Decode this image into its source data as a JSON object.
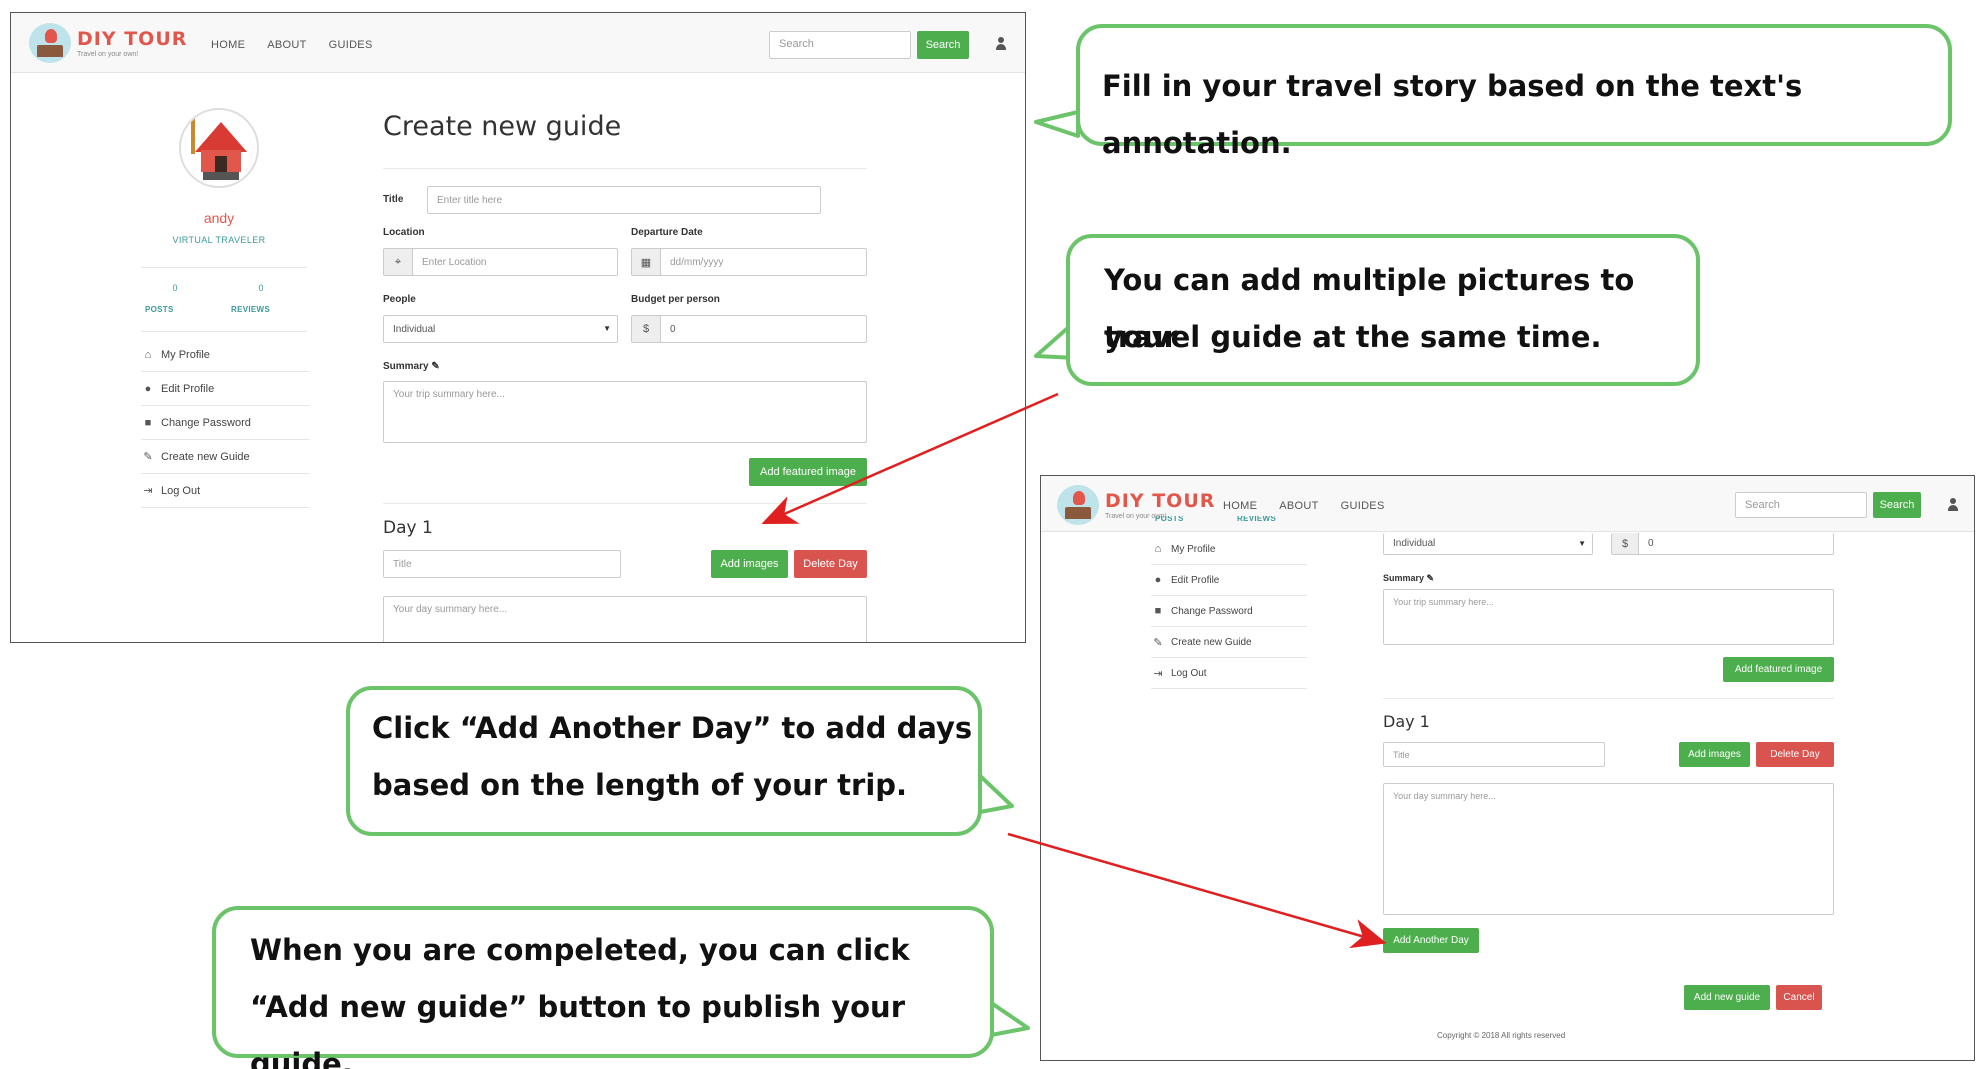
{
  "brand": {
    "name": "DIY TOUR",
    "tagline": "Travel on your own!"
  },
  "nav": {
    "links": [
      "HOME",
      "ABOUT",
      "GUIDES"
    ],
    "search_placeholder": "Search",
    "search_button": "Search"
  },
  "profile": {
    "name": "andy",
    "role": "VIRTUAL TRAVELER",
    "posts_count": "0",
    "posts_label": "POSTS",
    "reviews_count": "0",
    "reviews_label": "REVIEWS"
  },
  "menu": [
    {
      "label": "My Profile",
      "icon": "home-icon"
    },
    {
      "label": "Edit Profile",
      "icon": "user-icon"
    },
    {
      "label": "Change Password",
      "icon": "lock-icon"
    },
    {
      "label": "Create new Guide",
      "icon": "pencil-icon"
    },
    {
      "label": "Log Out",
      "icon": "logout-icon"
    }
  ],
  "form": {
    "page_title": "Create new guide",
    "title_label": "Title",
    "title_placeholder": "Enter title here",
    "location_label": "Location",
    "location_placeholder": "Enter Location",
    "departure_label": "Departure Date",
    "departure_placeholder": "dd/mm/yyyy",
    "people_label": "People",
    "people_value": "Individual",
    "budget_label": "Budget per person",
    "budget_prefix": "$",
    "budget_value": "0",
    "summary_label": "Summary",
    "summary_placeholder": "Your trip summary here...",
    "featured_button": "Add featured image"
  },
  "day": {
    "title": "Day 1",
    "title_placeholder": "Title",
    "add_images_button": "Add images",
    "delete_day_button": "Delete Day",
    "summary_placeholder": "Your day summary here...",
    "add_day_button": "Add Another Day"
  },
  "footer_actions": {
    "add_guide_button": "Add new guide",
    "cancel_button": "Cancel"
  },
  "copyright": "Copyright © 2018 All rights reserved",
  "callouts": {
    "c1": [
      "Fill in your travel story based on the text's annotation."
    ],
    "c2": [
      "You can add multiple pictures to your",
      "travel guide at the same time."
    ],
    "c3": [
      "Click “Add Another Day” to add days",
      "based on the length of your trip."
    ],
    "c4": [
      "When you are compeleted, you can click",
      "“Add new guide” button to publish your guide."
    ]
  },
  "colors": {
    "accent_green": "#4cae4c",
    "danger_red": "#d9534f",
    "brand_red": "#e2574c",
    "callout_border": "#6cc46a",
    "arrow": "#e02020"
  }
}
